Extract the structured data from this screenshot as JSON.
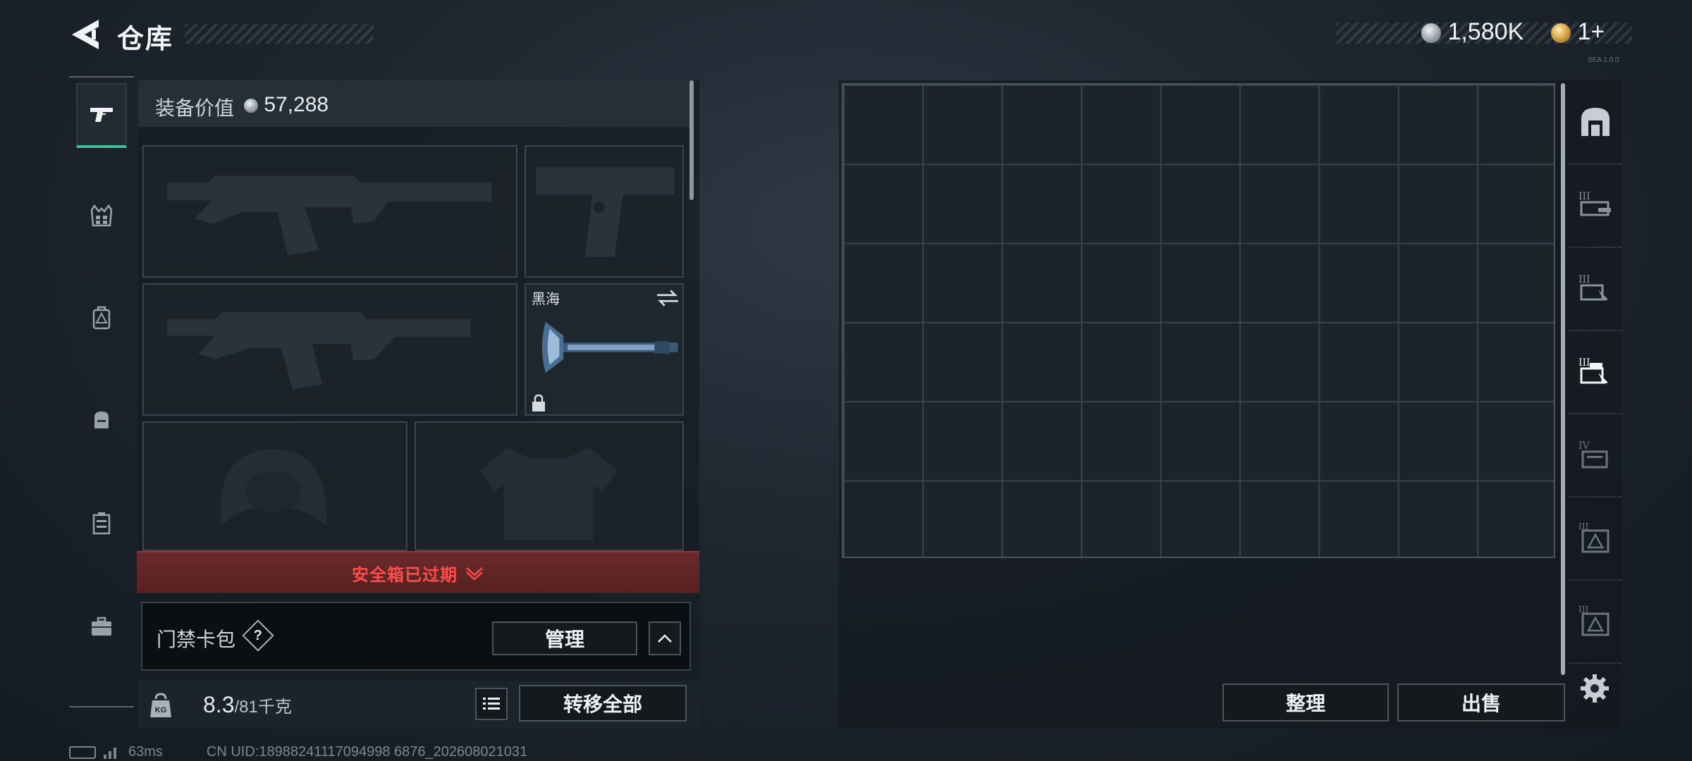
{
  "header": {
    "title": "仓库",
    "currency": [
      {
        "name": "silver-coin",
        "value": "1,580K"
      },
      {
        "name": "gold-coin",
        "value": "1+"
      }
    ],
    "version_tag": "SEA 1.0.0"
  },
  "left_nav": {
    "items": [
      {
        "icon": "pistol-icon",
        "active": true
      },
      {
        "icon": "vest-icon",
        "active": false
      },
      {
        "icon": "backpack-icon",
        "active": false
      },
      {
        "icon": "pouch-icon",
        "active": false
      },
      {
        "icon": "case-icon",
        "active": false
      },
      {
        "icon": "toolbox-icon",
        "active": false
      }
    ]
  },
  "equipment": {
    "label": "装备价值",
    "value": "57,288",
    "slots": [
      {
        "name": "primary-weapon-slot",
        "item": "rifle-silhouette"
      },
      {
        "name": "pistol-slot",
        "item": "pistol-silhouette"
      },
      {
        "name": "secondary-weapon-slot",
        "item": "rifle-silhouette"
      },
      {
        "name": "melee-slot",
        "item": "axe",
        "label": "黑海",
        "locked": true
      },
      {
        "name": "helmet-slot",
        "item": "helmet-silhouette"
      },
      {
        "name": "armor-slot",
        "item": "armor-silhouette"
      }
    ],
    "expired_text": "安全箱已过期",
    "keycard": {
      "label": "门禁卡包",
      "help": "?",
      "manage_label": "管理"
    },
    "weight": {
      "unit_icon": "KG",
      "current": "8.3",
      "max": "/81千克"
    },
    "transfer_label": "转移全部"
  },
  "storage": {
    "grid_cols": 9,
    "grid_rows": 6,
    "tidy_label": "整理",
    "sell_label": "出售"
  },
  "right_tabs": [
    {
      "icon": "storage-home-icon",
      "active": true
    },
    {
      "icon": "tier-3-shelf-icon",
      "active": false
    },
    {
      "icon": "tier-3-rack-icon",
      "active": false
    },
    {
      "icon": "tier-3-selected-rack-icon",
      "active": true
    },
    {
      "icon": "tier-4-folder-icon",
      "active": false
    },
    {
      "icon": "pyramid-box-icon",
      "active": false
    },
    {
      "icon": "pyramid-box-2-icon",
      "active": false
    }
  ],
  "status": {
    "ping": "63ms",
    "uid": "CN UID:18988241117094998 6876_202608021031"
  },
  "colors": {
    "accent": "#3fbf94",
    "alert": "#ff4d4d",
    "alert_bg": "#5e2526"
  }
}
